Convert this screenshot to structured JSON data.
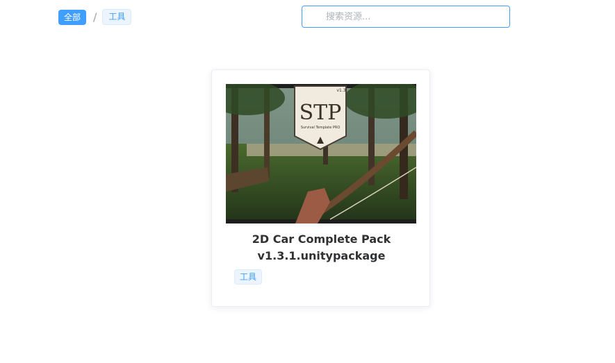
{
  "breadcrumb": {
    "all_label": "全部",
    "separator": "/",
    "current_label": "工具"
  },
  "search": {
    "placeholder": "搜索资源..."
  },
  "cards": [
    {
      "title_line1": "2D Car Complete Pack",
      "title_line2": "v1.3.1.unitypackage",
      "tag": "工具",
      "thumbnail": {
        "badge_text": "STP",
        "badge_subtext": "Survival Template PRO",
        "version_text": "v1.3"
      }
    }
  ],
  "colors": {
    "accent": "#409eff",
    "tag_bg": "#ecf5ff",
    "text": "#303133"
  }
}
